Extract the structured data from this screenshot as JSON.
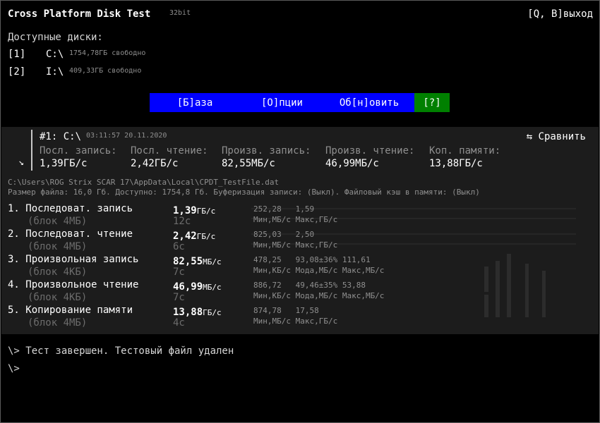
{
  "header": {
    "title": "Cross Platform Disk Test",
    "bitness": "32bit",
    "quit": "[Q, В]выход"
  },
  "drives": {
    "label": "Доступные диски:",
    "items": [
      {
        "index": "[1]",
        "name": "C:\\",
        "free": "1754,78ГБ свободно"
      },
      {
        "index": "[2]",
        "name": "I:\\",
        "free": "409,33ГБ свободно"
      }
    ]
  },
  "menu": {
    "base": "[Б]аза",
    "options": "[О]пции",
    "refresh": "Об[н]овить",
    "help": "[?]",
    "colors": {
      "blue": "#0000ff",
      "green": "#008000"
    }
  },
  "summary": {
    "run_title": "#1: C:\\",
    "timestamp": "03:11:57 20.11.2020",
    "compare": "⇆ Сравнить",
    "collapse_icon": "↘",
    "columns": [
      {
        "label": "Посл. запись:",
        "value": "1,39ГБ/с"
      },
      {
        "label": "Посл. чтение:",
        "value": "2,42ГБ/с"
      },
      {
        "label": "Произв. запись:",
        "value": "82,55МБ/с"
      },
      {
        "label": "Произв. чтение:",
        "value": "46,99МБ/с"
      },
      {
        "label": "Коп. памяти:",
        "value": "13,88ГБ/с"
      }
    ]
  },
  "file_info": {
    "path": "C:\\Users\\ROG Strix SCAR 17\\AppData\\Local\\CPDT_TestFile.dat",
    "details": "Размер файла: 16,0 Гб. Доступно: 1754,8 Гб. Буферизация записи: (Выкл). Файловый кэш в памяти: (Выкл)"
  },
  "tests": [
    {
      "name": "1. Последоват. запись",
      "block": "(блок 4МБ)",
      "value": "1,39",
      "unit": "ГБ/с",
      "time": "12с",
      "stats_values": "252,28   1,59",
      "stats_labels": "Мин,МБ/с Макс,ГБ/с"
    },
    {
      "name": "2. Последоват. чтение",
      "block": "(блок 4МБ)",
      "value": "2,42",
      "unit": "ГБ/с",
      "time": "6с",
      "stats_values": "825,03   2,50",
      "stats_labels": "Мин,МБ/с Макс,ГБ/с"
    },
    {
      "name": "3. Произвольная запись",
      "block": "(блок 4КБ)",
      "value": "82,55",
      "unit": "МБ/с",
      "time": "7с",
      "stats_values": "478,25   93,08±36% 111,61",
      "stats_labels": "Мин,КБ/с Мода,МБ/с Макс,МБ/с"
    },
    {
      "name": "4. Произвольное чтение",
      "block": "(блок 4КБ)",
      "value": "46,99",
      "unit": "МБ/с",
      "time": "7с",
      "stats_values": "886,72   49,46±35% 53,88",
      "stats_labels": "Мин,КБ/с Мода,МБ/с Макс,МБ/с"
    },
    {
      "name": "5. Копирование памяти",
      "block": "(блок 4МБ)",
      "value": "13,88",
      "unit": "ГБ/с",
      "time": "4с",
      "stats_values": "874,78   17,58",
      "stats_labels": "Мин,МБ/с Макс,ГБ/с"
    }
  ],
  "console": {
    "line1": "\\> Тест завершен. Тестовый файл удален",
    "line2": "\\>"
  }
}
